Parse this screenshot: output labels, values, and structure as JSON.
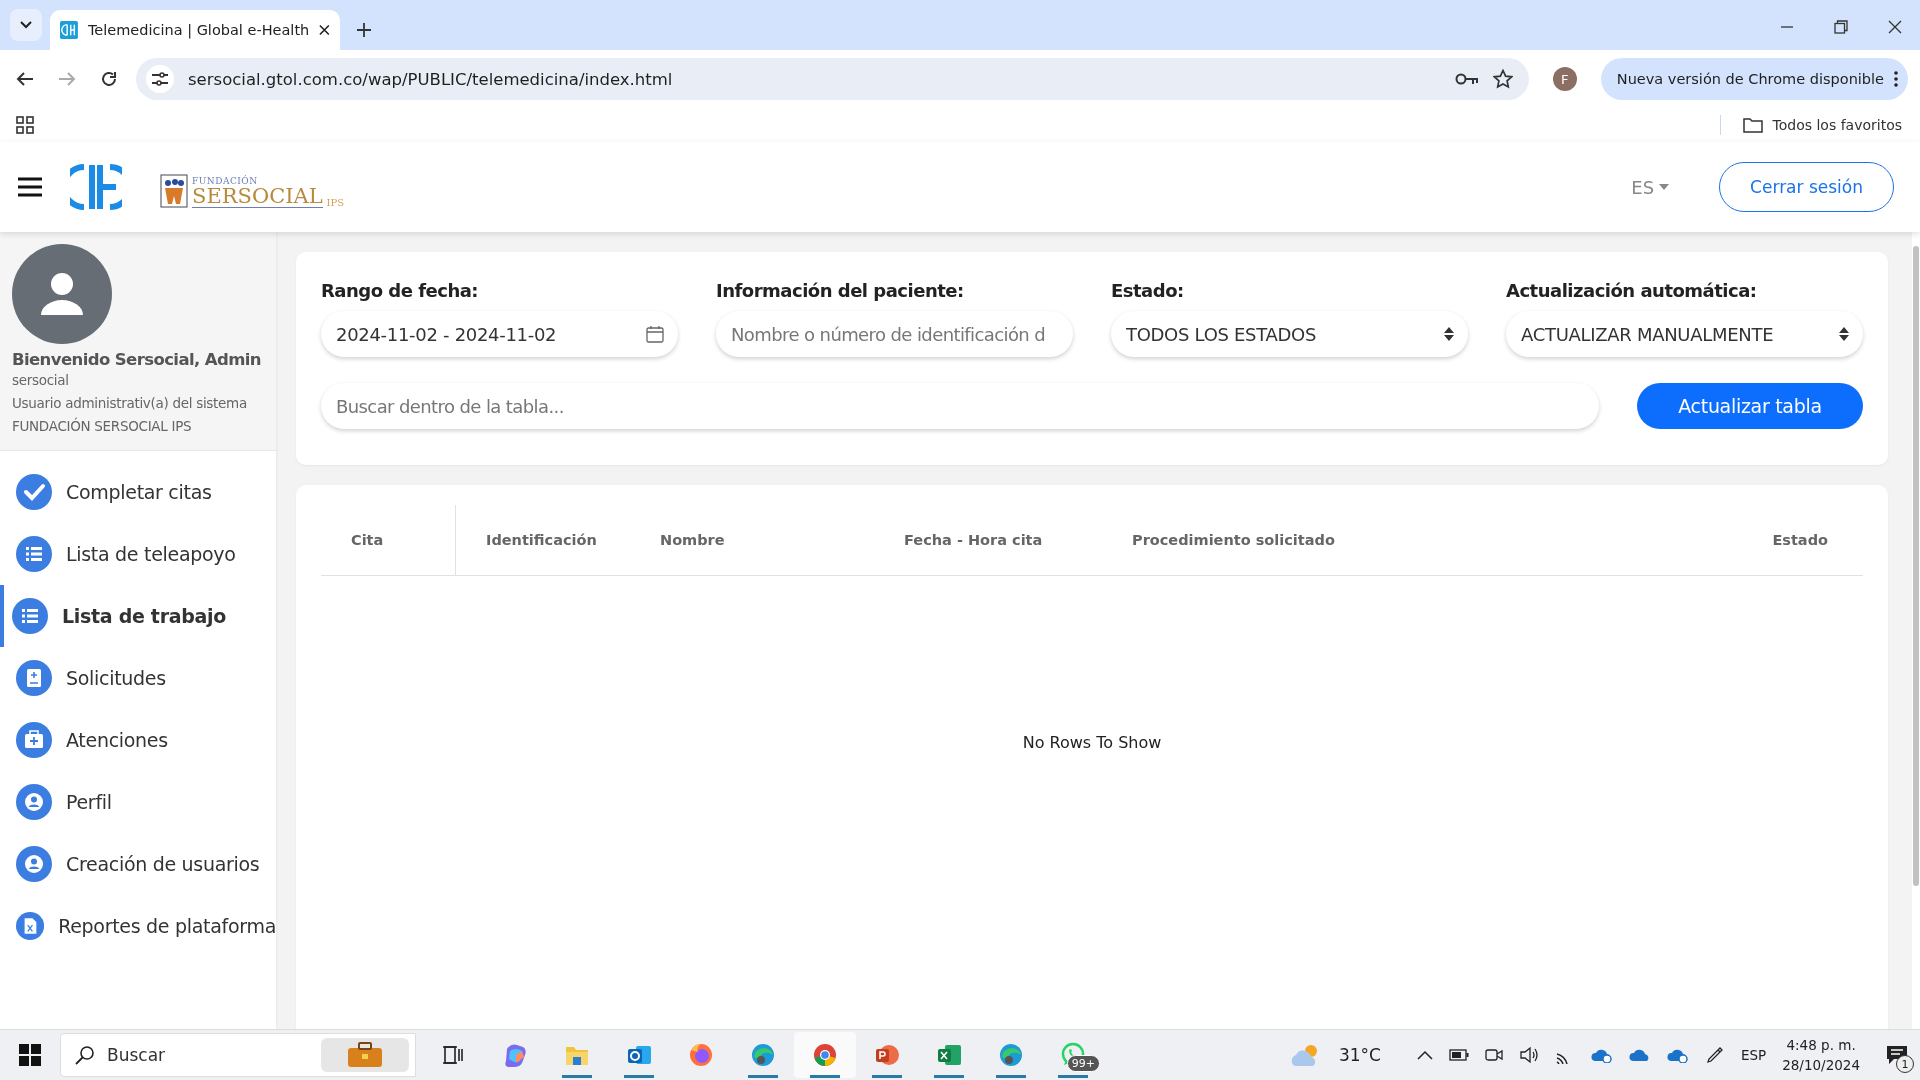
{
  "browser": {
    "tab_title": "Telemedicina | Global e-Health",
    "url": "sersocial.gtol.com.co/wap/PUBLIC/telemedicina/index.html",
    "profile_initial": "F",
    "update_label": "Nueva versión de Chrome disponible",
    "bookmarks_label": "Todos los favoritos"
  },
  "header": {
    "logo": {
      "top": "FUNDACIÓN",
      "main": "SERSOCIAL",
      "suffix": "IPS"
    },
    "language": "ES",
    "logout": "Cerrar sesión"
  },
  "profile": {
    "greeting": "Bienvenido Sersocial, Admin",
    "username": "sersocial",
    "role": "Usuario administrativ(a) del sistema",
    "organization": "FUNDACIÓN SERSOCIAL IPS"
  },
  "menu": [
    {
      "label": "Completar citas",
      "kind": "check",
      "selected": false
    },
    {
      "label": "Lista de teleapoyo",
      "kind": "list",
      "selected": false
    },
    {
      "label": "Lista de trabajo",
      "kind": "list",
      "selected": true
    },
    {
      "label": "Solicitudes",
      "kind": "request",
      "selected": false
    },
    {
      "label": "Atenciones",
      "kind": "kit",
      "selected": false
    },
    {
      "label": "Perfil",
      "kind": "user",
      "selected": false
    },
    {
      "label": "Creación de usuarios",
      "kind": "user",
      "selected": false
    },
    {
      "label": "Reportes de plataforma",
      "kind": "excel",
      "selected": false
    }
  ],
  "filters": [
    {
      "label": "Rango de fecha:",
      "kind": "date",
      "value": "2024-11-02 - 2024-11-02"
    },
    {
      "label": "Información del paciente:",
      "kind": "text",
      "placeholder": "Nombre o número de identificación d"
    },
    {
      "label": "Estado:",
      "kind": "select",
      "value": "TODOS LOS ESTADOS"
    },
    {
      "label": "Actualización automática:",
      "kind": "select",
      "value": "ACTUALIZAR MANUALMENTE"
    }
  ],
  "search": {
    "placeholder": "Buscar dentro de la tabla..."
  },
  "refresh_button": "Actualizar tabla",
  "table": {
    "columns": [
      "Cita",
      "Identificación",
      "Nombre",
      "Fecha - Hora cita",
      "Procedimiento solicitado",
      "Estado"
    ],
    "empty_message": "No Rows To Show"
  },
  "taskbar": {
    "search_placeholder": "Buscar",
    "apps": [
      {
        "kind": "taskview",
        "running": false,
        "active": false
      },
      {
        "kind": "copilot",
        "running": false,
        "active": false
      },
      {
        "kind": "files",
        "running": true,
        "active": false
      },
      {
        "kind": "outlook",
        "running": true,
        "active": false
      },
      {
        "kind": "firefox",
        "running": false,
        "active": false
      },
      {
        "kind": "edge",
        "running": true,
        "active": false
      },
      {
        "kind": "chrome",
        "running": true,
        "active": true
      },
      {
        "kind": "powerpoint",
        "running": true,
        "active": false
      },
      {
        "kind": "excel",
        "running": true,
        "active": false
      },
      {
        "kind": "edge",
        "running": true,
        "active": false
      },
      {
        "kind": "whatsapp",
        "running": true,
        "active": false,
        "badge": "99+"
      }
    ],
    "temperature": "31°C",
    "language": "ESP",
    "time": "4:48 p. m.",
    "date": "28/10/2024",
    "notifications": "1"
  }
}
